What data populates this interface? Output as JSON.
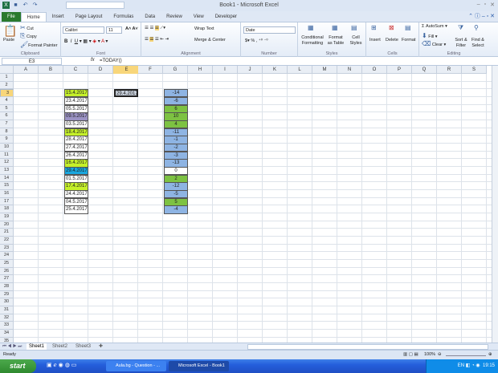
{
  "window": {
    "title": "Book1 - Microsoft Excel"
  },
  "ribbon_tabs": [
    "File",
    "Home",
    "Insert",
    "Page Layout",
    "Formulas",
    "Data",
    "Review",
    "View",
    "Developer"
  ],
  "clipboard": {
    "paste": "Paste",
    "cut": "Cut",
    "copy": "Copy",
    "format_painter": "Format Painter",
    "label": "Clipboard"
  },
  "font": {
    "name": "Calibri",
    "size": "11",
    "label": "Font"
  },
  "alignment": {
    "wrap": "Wrap Text",
    "merge": "Merge & Center",
    "label": "Alignment"
  },
  "number": {
    "format": "Date",
    "label": "Number"
  },
  "styles": {
    "conditional": "Conditional Formatting",
    "format_table": "Format as Table",
    "cell_styles": "Cell Styles",
    "label": "Styles"
  },
  "cells": {
    "insert": "Insert",
    "delete": "Delete",
    "format": "Format",
    "label": "Cells"
  },
  "editing": {
    "autosum": "AutoSum",
    "fill": "Fill",
    "clear": "Clear",
    "sort": "Sort & Filter",
    "find": "Find & Select",
    "label": "Editing"
  },
  "formula_bar": {
    "name_box": "E3",
    "fx": "fx",
    "formula": "=TODAY()"
  },
  "columns": [
    "A",
    "B",
    "C",
    "D",
    "E",
    "F",
    "G",
    "H",
    "I",
    "J",
    "K",
    "L",
    "M",
    "N",
    "O",
    "P",
    "Q",
    "R",
    "S"
  ],
  "selected_column": "E",
  "selected_row": 3,
  "row_count": 35,
  "colors": {
    "yellow_green": "#c5f02a",
    "purple": "#9b93c4",
    "cyan": "#1aa7df",
    "blue": "#8eb4e3",
    "green": "#7dc242",
    "white": "#ffffff",
    "gray": "#c9d1dc"
  },
  "column_c": [
    {
      "v": "15.4.2017",
      "c": "yellow_green"
    },
    {
      "v": "23.4.2017",
      "c": "white"
    },
    {
      "v": "05.5.2017",
      "c": "white"
    },
    {
      "v": "09.5.2017",
      "c": "purple"
    },
    {
      "v": "03.5.2017",
      "c": "white"
    },
    {
      "v": "18.4.2017",
      "c": "yellow_green"
    },
    {
      "v": "28.4.2017",
      "c": "white"
    },
    {
      "v": "27.4.2017",
      "c": "white"
    },
    {
      "v": "26.4.2017",
      "c": "white"
    },
    {
      "v": "16.4.2017",
      "c": "yellow_green"
    },
    {
      "v": "29.4.2017",
      "c": "cyan"
    },
    {
      "v": "01.5.2017",
      "c": "white"
    },
    {
      "v": "17.4.2017",
      "c": "yellow_green"
    },
    {
      "v": "24.4.2017",
      "c": "white"
    },
    {
      "v": "04.5.2017",
      "c": "white"
    },
    {
      "v": "25.4.2017",
      "c": "white"
    }
  ],
  "cell_e3": "29.4.2017",
  "column_g": [
    {
      "v": "-14",
      "c": "blue"
    },
    {
      "v": "-6",
      "c": "blue"
    },
    {
      "v": "6",
      "c": "green"
    },
    {
      "v": "10",
      "c": "green"
    },
    {
      "v": "4",
      "c": "green"
    },
    {
      "v": "-11",
      "c": "blue"
    },
    {
      "v": "-1",
      "c": "blue"
    },
    {
      "v": "-2",
      "c": "blue"
    },
    {
      "v": "-3",
      "c": "blue"
    },
    {
      "v": "-13",
      "c": "blue"
    },
    {
      "v": "0",
      "c": "white"
    },
    {
      "v": "2",
      "c": "green"
    },
    {
      "v": "-12",
      "c": "blue"
    },
    {
      "v": "-5",
      "c": "blue"
    },
    {
      "v": "5",
      "c": "green"
    },
    {
      "v": "-4",
      "c": "blue"
    }
  ],
  "sheets": [
    "Sheet1",
    "Sheet2",
    "Sheet3"
  ],
  "status": {
    "ready": "Ready",
    "zoom": "100%"
  },
  "taskbar": {
    "start": "start",
    "items": [
      "Aula.bg - Question - ...",
      "Microsoft Excel - Book1"
    ],
    "lang": "EN",
    "clock": "19:15"
  }
}
